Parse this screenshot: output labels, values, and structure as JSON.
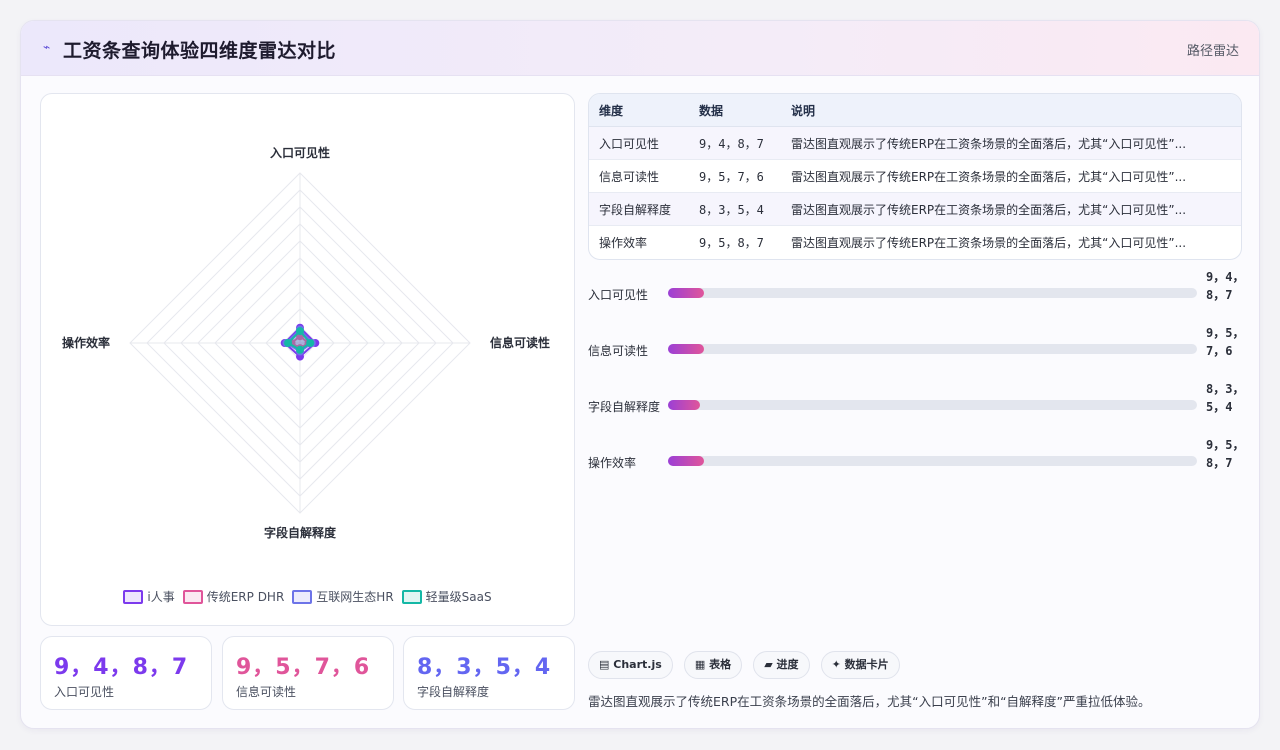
{
  "header": {
    "logo_icon": "⌁",
    "title": "工资条查询体验四维度雷达对比",
    "tag": "路径雷达"
  },
  "chart_data": {
    "type": "radar",
    "axes": [
      "入口可见性",
      "信息可读性",
      "字段自解释度",
      "操作效率"
    ],
    "range": [
      0,
      100
    ],
    "rings": 10,
    "series": [
      {
        "name": "i人事",
        "values": [
          9,
          9,
          8,
          9
        ],
        "color": "#7c3aed"
      },
      {
        "name": "传统ERP DHR",
        "values": [
          4,
          5,
          3,
          5
        ],
        "color": "#e0559a"
      },
      {
        "name": "互联网生态HR",
        "values": [
          8,
          7,
          5,
          8
        ],
        "color": "#6d74e8"
      },
      {
        "name": "轻量级SaaS",
        "values": [
          7,
          6,
          4,
          7
        ],
        "color": "#14b8a6"
      }
    ]
  },
  "table": {
    "headers": [
      "维度",
      "数据",
      "说明"
    ],
    "rows": [
      {
        "dim": "入口可见性",
        "data": "9，4，8，7",
        "desc": "雷达图直观展示了传统ERP在工资条场景的全面落后，尤其“入口可见性”..."
      },
      {
        "dim": "信息可读性",
        "data": "9，5，7，6",
        "desc": "雷达图直观展示了传统ERP在工资条场景的全面落后，尤其“入口可见性”..."
      },
      {
        "dim": "字段自解释度",
        "data": "8，3，5，4",
        "desc": "雷达图直观展示了传统ERP在工资条场景的全面落后，尤其“入口可见性”..."
      },
      {
        "dim": "操作效率",
        "data": "9，5，8，7",
        "desc": "雷达图直观展示了传统ERP在工资条场景的全面落后，尤其“入口可见性”..."
      }
    ]
  },
  "progress": [
    {
      "label": "入口可见性",
      "value_text": "9，4，8，7",
      "fill_fraction": 0.068
    },
    {
      "label": "信息可读性",
      "value_text": "9，5，7，6",
      "fill_fraction": 0.068
    },
    {
      "label": "字段自解释度",
      "value_text": "8，3，5，4",
      "fill_fraction": 0.06
    },
    {
      "label": "操作效率",
      "value_text": "9，5，8，7",
      "fill_fraction": 0.068
    }
  ],
  "stats": [
    {
      "value": "9，4，8，7",
      "label": "入口可见性",
      "color": "#7c3aed"
    },
    {
      "value": "9，5，7，6",
      "label": "信息可读性",
      "color": "#e0559a"
    },
    {
      "value": "8，3，5，4",
      "label": "字段自解释度",
      "color": "#6366f1"
    }
  ],
  "chips": [
    {
      "icon": "chart-icon",
      "glyph": "▤",
      "label": "Chart.js"
    },
    {
      "icon": "table-icon",
      "glyph": "▦",
      "label": "表格"
    },
    {
      "icon": "progress-icon",
      "glyph": "▰",
      "label": "进度"
    },
    {
      "icon": "sparkle-icon",
      "glyph": "✦",
      "label": "数据卡片"
    }
  ],
  "note": "雷达图直观展示了传统ERP在工资条场景的全面落后，尤其“入口可见性”和“自解释度”严重拉低体验。"
}
